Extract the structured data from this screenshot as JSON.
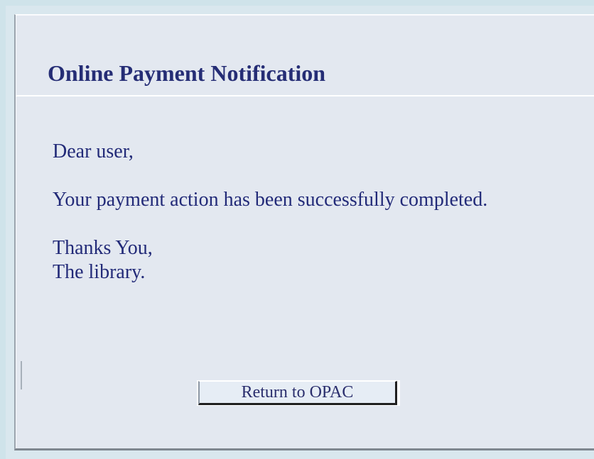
{
  "notification": {
    "title": "Online Payment Notification",
    "greeting": "Dear user,",
    "message": "Your payment action has been successfully completed.",
    "closing": "Thanks You,",
    "signature": "The library."
  },
  "actions": {
    "return_label": "Return to OPAC"
  },
  "colors": {
    "background": "#cfe3ea",
    "panel": "#e3e8f0",
    "text": "#222a78",
    "button": "#e6edf5"
  }
}
